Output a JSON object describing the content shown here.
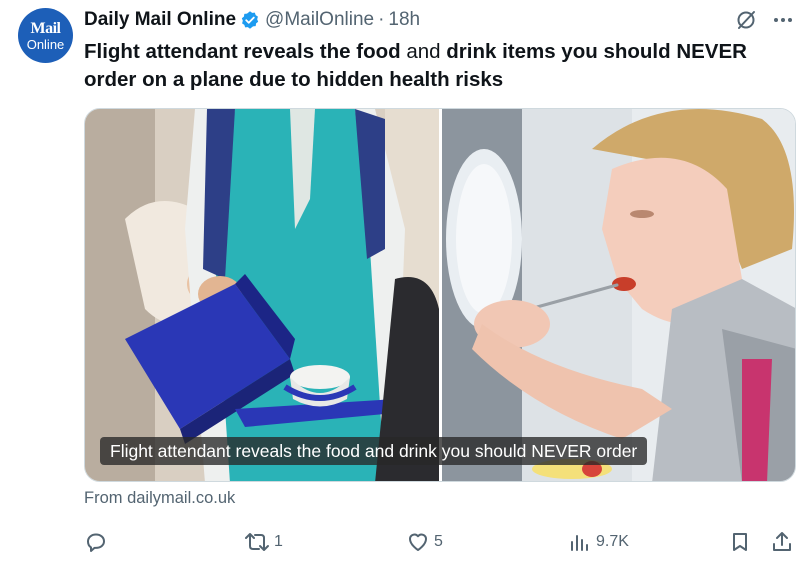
{
  "account": {
    "avatar_line1": "Mail",
    "avatar_line2": "Online",
    "display_name": "Daily Mail Online",
    "handle": "@MailOnline",
    "separator": "·",
    "time": "18h"
  },
  "tweet": {
    "segments": [
      {
        "text": "Flight attendant reveals the food",
        "bold": true
      },
      {
        "text": " and ",
        "bold": false
      },
      {
        "text": "drink items you should NEVER order on a plane due to hidden health risks",
        "bold": true
      }
    ]
  },
  "media": {
    "caption": "Flight attendant reveals the food and drink you should NEVER order"
  },
  "link_source": "From dailymail.co.uk",
  "actions": {
    "reply_count": "",
    "retweet_count": "1",
    "like_count": "5",
    "views_count": "9.7K"
  },
  "icons": {
    "verified": "verified-badge-icon",
    "grok": "grok-icon",
    "more": "more-icon",
    "reply": "reply-icon",
    "retweet": "retweet-icon",
    "like": "heart-icon",
    "views": "views-icon",
    "bookmark": "bookmark-icon",
    "share": "share-icon"
  },
  "colors": {
    "verified_blue": "#1d9bf0",
    "avatar_bg": "#1d5fb8",
    "secondary_text": "#536471"
  }
}
